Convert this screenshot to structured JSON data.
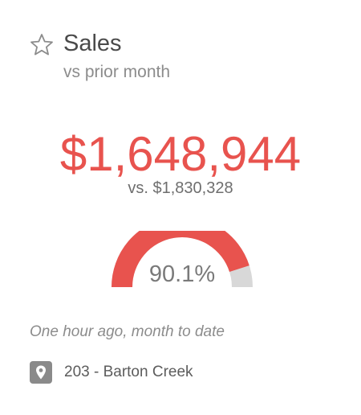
{
  "card": {
    "title": "Sales",
    "subtitle": "vs prior month",
    "value": "$1,648,944",
    "comparison": "vs. $1,830,328",
    "percent_label": "90.1%",
    "percent_fraction": 0.901,
    "timestamp": "One hour ago, month to date",
    "location": "203 - Barton Creek",
    "icons": {
      "favorite": "star-outline-icon",
      "location": "map-pin-icon"
    },
    "colors": {
      "value": "#e8534e",
      "gauge_fill": "#e8534e",
      "gauge_track": "#d8d8d8",
      "location_badge": "#8a8a8a"
    }
  }
}
